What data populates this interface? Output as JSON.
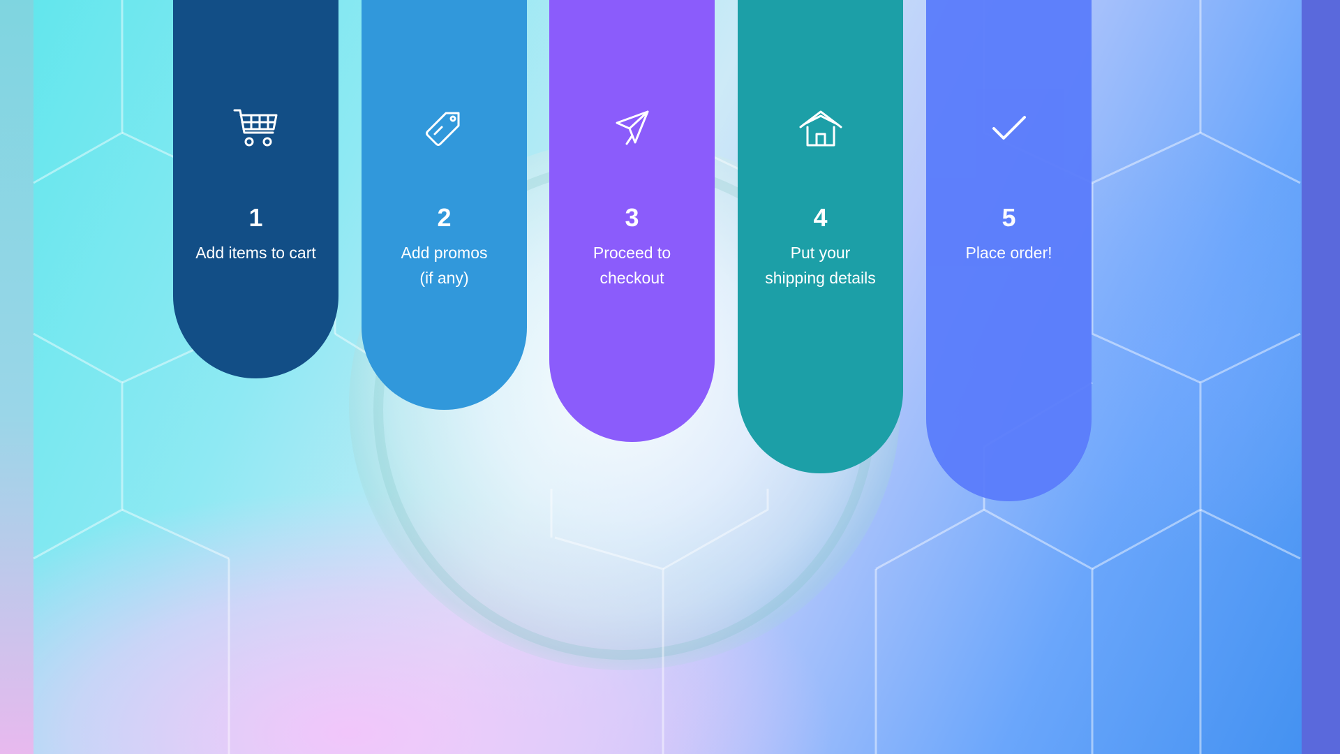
{
  "colors": {
    "step1": "#124e86",
    "step2": "#3198db",
    "step3": "#8b5cfb",
    "step4": "#1c9fa7",
    "step5": "#5b7dfb"
  },
  "steps": [
    {
      "number": "1",
      "lines": [
        "Add items to cart"
      ],
      "icon": "shopping-cart-icon"
    },
    {
      "number": "2",
      "lines": [
        "Add promos",
        "(if any)"
      ],
      "icon": "price-tag-icon"
    },
    {
      "number": "3",
      "lines": [
        "Proceed to",
        "checkout"
      ],
      "icon": "paper-plane-icon"
    },
    {
      "number": "4",
      "lines": [
        "Put your",
        "shipping details"
      ],
      "icon": "house-icon"
    },
    {
      "number": "5",
      "lines": [
        "Place order!"
      ],
      "icon": "checkmark-icon"
    }
  ]
}
